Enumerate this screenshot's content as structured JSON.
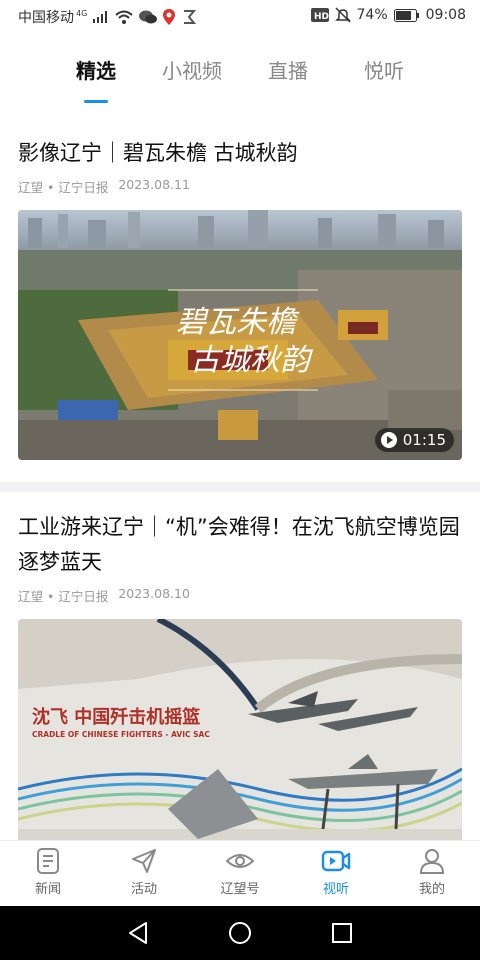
{
  "status_bar": {
    "carrier": "中国移动",
    "network": "4G",
    "battery": "74%",
    "time": "09:08"
  },
  "tabs": [
    {
      "label": "精选",
      "active": true
    },
    {
      "label": "小视频",
      "active": false
    },
    {
      "label": "直播",
      "active": false
    },
    {
      "label": "悦听",
      "active": false
    }
  ],
  "articles": [
    {
      "title": "影像辽宁｜碧瓦朱檐 古城秋韵",
      "source": "辽望 • 辽宁日报",
      "date": "2023.08.11",
      "overlay_line1": "碧瓦朱檐",
      "overlay_line2": "古城秋韵",
      "duration": "01:15"
    },
    {
      "title": "工业游来辽宁｜“机”会难得！在沈飞航空博览园逐梦蓝天",
      "source": "辽望 • 辽宁日报",
      "date": "2023.08.10",
      "sign_cn": "沈飞 中国歼击机摇篮",
      "sign_en": "CRADLE OF CHINESE FIGHTERS - AVIC SAC"
    }
  ],
  "bottom_nav": [
    {
      "label": "新闻",
      "icon": "news-icon",
      "active": false
    },
    {
      "label": "活动",
      "icon": "send-icon",
      "active": false
    },
    {
      "label": "辽望号",
      "icon": "eye-icon",
      "active": false
    },
    {
      "label": "视听",
      "icon": "video-icon",
      "active": true
    },
    {
      "label": "我的",
      "icon": "user-icon",
      "active": false
    }
  ],
  "colors": {
    "accent": "#1a8ee8"
  }
}
